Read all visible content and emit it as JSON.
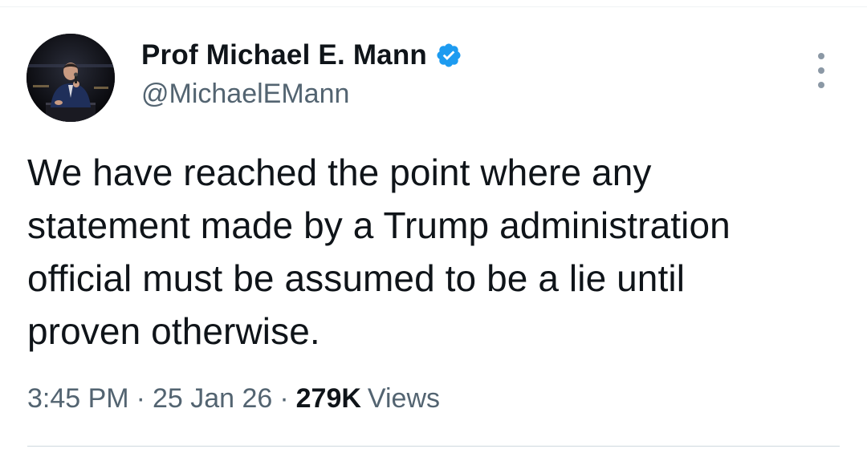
{
  "author": {
    "display_name": "Prof Michael E. Mann",
    "handle": "@MichaelEMann",
    "verified": true,
    "verified_color": "#1d9bf0"
  },
  "tweet": {
    "text_lines": [
      "We have reached the point where any",
      "statement made by a Trump administration",
      "official must be assumed to be a lie until",
      "proven otherwise."
    ]
  },
  "meta": {
    "time": "3:45 PM",
    "separator": "·",
    "date": "25 Jan 26",
    "views_count": "279K",
    "views_label": "Views"
  },
  "icons": {
    "verified": "verified-badge-icon",
    "more": "more-options-icon"
  }
}
